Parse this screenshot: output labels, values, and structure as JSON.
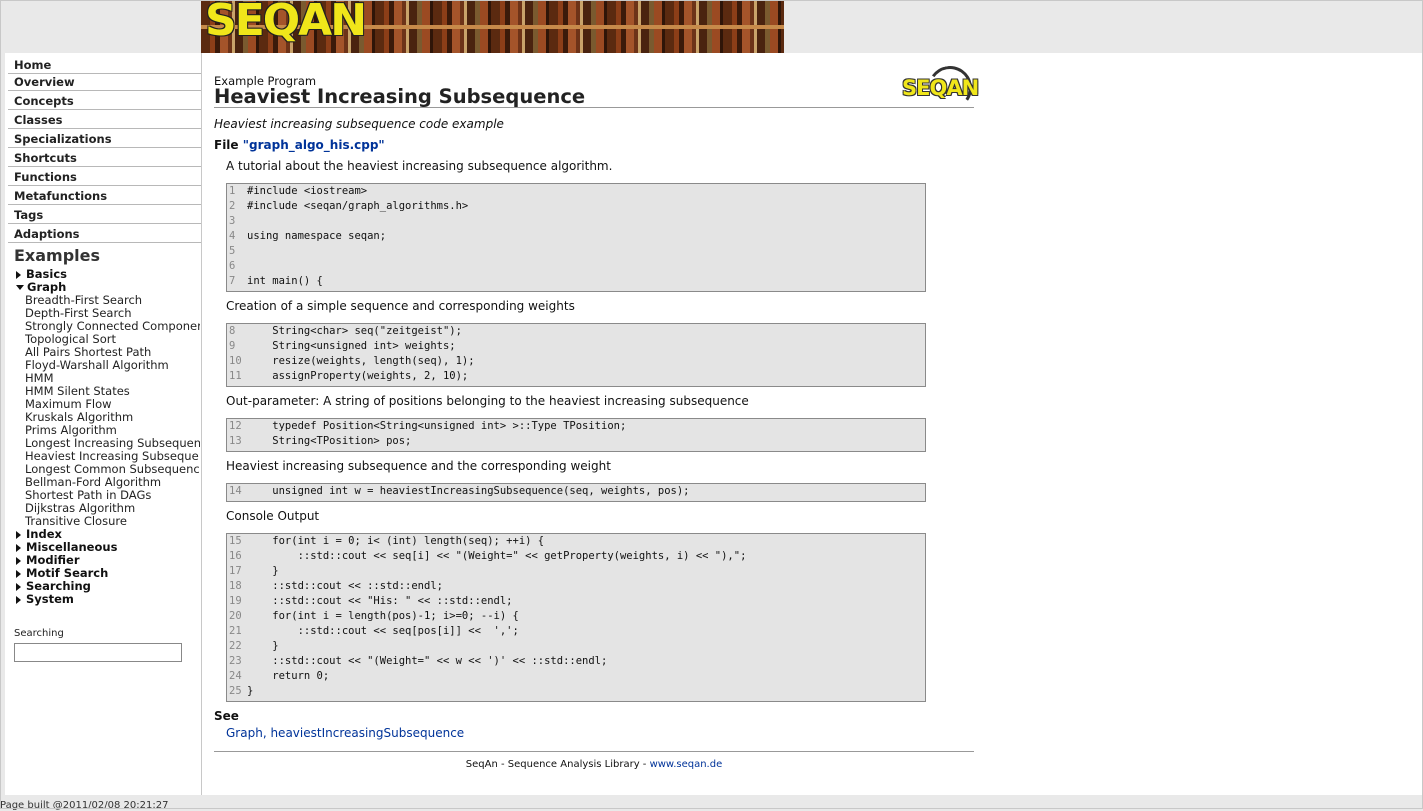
{
  "banner": {
    "logo_text": "SEQAN"
  },
  "nav": {
    "items": [
      "Home",
      "Overview",
      "Concepts",
      "Classes",
      "Specializations",
      "Shortcuts",
      "Functions",
      "Metafunctions",
      "Tags",
      "Adaptions"
    ]
  },
  "examples": {
    "heading": "Examples",
    "categories": {
      "basics": "Basics",
      "graph": "Graph",
      "index": "Index",
      "miscellaneous": "Miscellaneous",
      "modifier": "Modifier",
      "motif_search": "Motif Search",
      "searching": "Searching",
      "system": "System"
    },
    "graph_items": [
      "Breadth-First Search",
      "Depth-First Search",
      "Strongly Connected Componer",
      "Topological Sort",
      "All Pairs Shortest Path",
      "Floyd-Warshall Algorithm",
      "HMM",
      "HMM Silent States",
      "Maximum Flow",
      "Kruskals Algorithm",
      "Prims Algorithm",
      "Longest Increasing Subsequen",
      "Heaviest Increasing Subseque",
      "Longest Common Subsequence",
      "Bellman-Ford Algorithm",
      "Shortest Path in DAGs",
      "Dijkstras Algorithm",
      "Transitive Closure"
    ]
  },
  "search": {
    "label": "Searching",
    "value": ""
  },
  "main": {
    "kind": "Example Program",
    "title": "Heaviest Increasing Subsequence",
    "logo_text": "SEQAN",
    "summary": "Heaviest increasing subsequence code example",
    "file_prefix": "File ",
    "file_name": "\"graph_algo_his.cpp\"",
    "sections": [
      {
        "desc": "A tutorial about the heaviest increasing subsequence algorithm.",
        "lines": [
          {
            "n": "1",
            "code": "#include <iostream>"
          },
          {
            "n": "2",
            "code": "#include <seqan/graph_algorithms.h>"
          },
          {
            "n": "3",
            "code": ""
          },
          {
            "n": "4",
            "code": "using namespace seqan;"
          },
          {
            "n": "5",
            "code": ""
          },
          {
            "n": "6",
            "code": ""
          },
          {
            "n": "7",
            "code": "int main() {"
          }
        ]
      },
      {
        "desc": "Creation of a simple sequence and corresponding weights",
        "lines": [
          {
            "n": "8",
            "code": "    String<char> seq(\"zeitgeist\");"
          },
          {
            "n": "9",
            "code": "    String<unsigned int> weights;"
          },
          {
            "n": "10",
            "code": "    resize(weights, length(seq), 1);"
          },
          {
            "n": "11",
            "code": "    assignProperty(weights, 2, 10);"
          }
        ]
      },
      {
        "desc": "Out-parameter: A string of positions belonging to the heaviest increasing subsequence",
        "lines": [
          {
            "n": "12",
            "code": "    typedef Position<String<unsigned int> >::Type TPosition;"
          },
          {
            "n": "13",
            "code": "    String<TPosition> pos;"
          }
        ]
      },
      {
        "desc": "Heaviest increasing subsequence and the corresponding weight",
        "lines": [
          {
            "n": "14",
            "code": "    unsigned int w = heaviestIncreasingSubsequence(seq, weights, pos);"
          }
        ]
      },
      {
        "desc": "Console Output",
        "lines": [
          {
            "n": "15",
            "code": "    for(int i = 0; i< (int) length(seq); ++i) {"
          },
          {
            "n": "16",
            "code": "        ::std::cout << seq[i] << \"(Weight=\" << getProperty(weights, i) << \"),\";"
          },
          {
            "n": "17",
            "code": "    }"
          },
          {
            "n": "18",
            "code": "    ::std::cout << ::std::endl;"
          },
          {
            "n": "19",
            "code": "    ::std::cout << \"His: \" << ::std::endl;"
          },
          {
            "n": "20",
            "code": "    for(int i = length(pos)-1; i>=0; --i) {"
          },
          {
            "n": "21",
            "code": "        ::std::cout << seq[pos[i]] <<  ',';"
          },
          {
            "n": "22",
            "code": "    }"
          },
          {
            "n": "23",
            "code": "    ::std::cout << \"(Weight=\" << w << ')' << ::std::endl;"
          },
          {
            "n": "24",
            "code": "    return 0;"
          },
          {
            "n": "25",
            "code": "}"
          }
        ]
      }
    ],
    "see_heading": "See",
    "see_links": [
      "Graph",
      "heaviestIncreasingSubsequence"
    ]
  },
  "footer": {
    "text": "SeqAn - Sequence Analysis Library - ",
    "link": "www.seqan.de"
  },
  "build_stamp": "Page built @2011/02/08 20:21:27"
}
